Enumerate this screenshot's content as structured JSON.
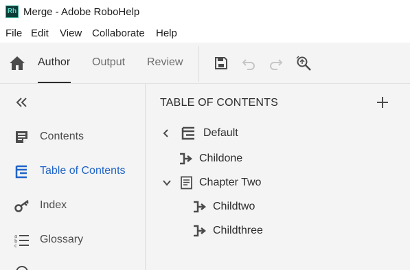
{
  "window": {
    "title": "Merge - Adobe RoboHelp",
    "logo_text": "Rh"
  },
  "menu": [
    "File",
    "Edit",
    "View",
    "Collaborate",
    "Help"
  ],
  "toolbar": {
    "tabs": [
      {
        "label": "Author",
        "active": true
      },
      {
        "label": "Output",
        "active": false
      },
      {
        "label": "Review",
        "active": false
      }
    ],
    "icons": [
      "home-icon",
      "save-icon",
      "undo-icon",
      "redo-icon",
      "search-replace-icon"
    ]
  },
  "sidebar": {
    "items": [
      {
        "label": "Contents",
        "icon": "contents-icon",
        "active": false
      },
      {
        "label": "Table of Contents",
        "icon": "toc-icon",
        "active": true
      },
      {
        "label": "Index",
        "icon": "key-icon",
        "active": false
      },
      {
        "label": "Glossary",
        "icon": "glossary-icon",
        "active": false
      }
    ]
  },
  "panel": {
    "title": "TABLE OF CONTENTS",
    "tree": [
      {
        "label": "Default",
        "type": "toc",
        "expanded": false,
        "level": 0
      },
      {
        "label": "Childone",
        "type": "topic-link",
        "level": 1
      },
      {
        "label": "Chapter Two",
        "type": "book",
        "expanded": true,
        "level": 1
      },
      {
        "label": "Childtwo",
        "type": "topic-link",
        "level": 2
      },
      {
        "label": "Childthree",
        "type": "topic-link",
        "level": 2
      }
    ]
  },
  "colors": {
    "accent": "#1f63c8",
    "panel_bg": "#f4f4f4",
    "text": "#2c2c2c"
  }
}
